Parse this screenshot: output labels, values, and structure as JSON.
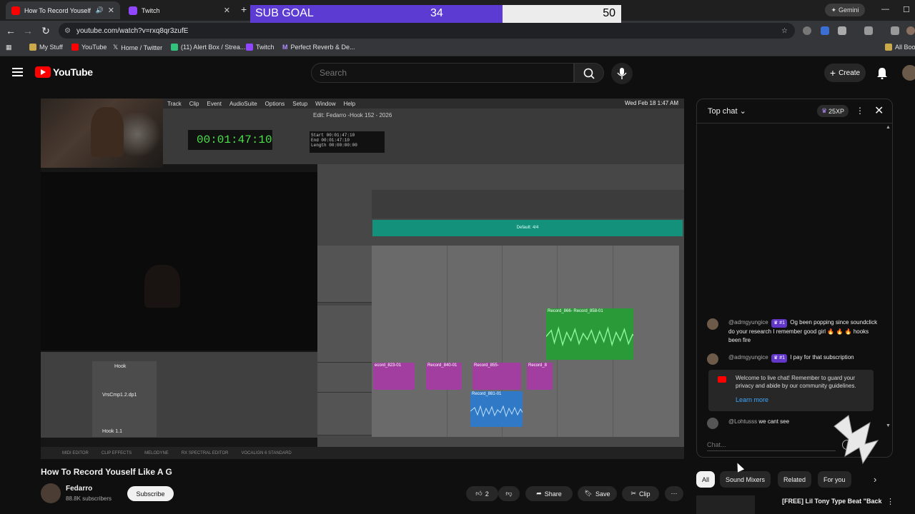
{
  "browser": {
    "tabs": [
      {
        "title": "How To Record Youself Like",
        "active": true
      },
      {
        "title": "Twitch",
        "active": false
      }
    ],
    "gemini_label": "Gemini",
    "url": "youtube.com/watch?v=rxq8qr3zufE",
    "bookmarks": [
      "My Stuff",
      "YouTube",
      "Home / Twitter",
      "(11) Alert Box / Strea...",
      "Twitch",
      "Perfect Reverb & De..."
    ],
    "all_bookmarks": "All Boo"
  },
  "sub_goal": {
    "label": "SUB GOAL",
    "current": "34",
    "target": "50",
    "progress": 0.68,
    "fill_color": "#5c3bd2"
  },
  "youtube": {
    "logo_text": "YouTube",
    "search_placeholder": "Search",
    "create_label": "Create"
  },
  "daw": {
    "menu": [
      "Track",
      "Clip",
      "Event",
      "AudioSuite",
      "Options",
      "Setup",
      "Window",
      "Help"
    ],
    "clock": "Wed Feb 18  1:47 AM",
    "session_title": "Edit: Fedarro -Hook 152 - 2026",
    "counter": "00:01:47:10",
    "counter_info": [
      "Start 00:01:47:10",
      "End 00:01:47:10",
      "Length 00:00:00:00"
    ],
    "tempo_track": "Default: 4/4",
    "tracks": [
      "Hook",
      "VrsCmp1.2.dp1",
      "Hook 1.1"
    ],
    "clips": [
      {
        "label": "Record_866-",
        "color": "green"
      },
      {
        "label": "Record_858-01",
        "color": "green"
      },
      {
        "label": "ecord_823-01",
        "color": "pink"
      },
      {
        "label": "Record_840-01",
        "color": "pink"
      },
      {
        "label": "Record_855-",
        "color": "pink"
      },
      {
        "label": "Record_8",
        "color": "pink"
      },
      {
        "label": "Record_881-01",
        "color": "blue"
      }
    ],
    "bottom_tabs": [
      "MIDI EDITOR",
      "CLIP EFFECTS",
      "MELODYNE",
      "RX SPECTRAL EDITOR",
      "VOCALIGN 6 STANDARD"
    ]
  },
  "video": {
    "title": "How To Record Youself Like A G",
    "channel": "Fedarro",
    "subscribers": "88.8K subscribers",
    "subscribe_label": "Subscribe",
    "likes": "2",
    "share_label": "Share",
    "save_label": "Save",
    "clip_label": "Clip"
  },
  "chat": {
    "mode": "Top chat",
    "xp": "25XP",
    "messages": [
      {
        "author": "@admgyungice",
        "badge": "#1",
        "text": "Og been popping since soundclick do your research I remember good girl 🔥 🔥 🔥 hooks been fire"
      },
      {
        "author": "@admgyungice",
        "badge": "#1",
        "text": "I pay for that subscription"
      },
      {
        "author": "@Lohtusss",
        "badge": "",
        "text": "we cant see"
      }
    ],
    "welcome": "Welcome to live chat! Remember to guard your privacy and abide by our community guidelines.",
    "learn_more": "Learn more",
    "input_placeholder": "Chat..."
  },
  "chips": [
    "All",
    "Sound Mixers",
    "Related",
    "For you"
  ],
  "recommended": {
    "title": "[FREE] Lil Tony Type Beat \"Back"
  }
}
